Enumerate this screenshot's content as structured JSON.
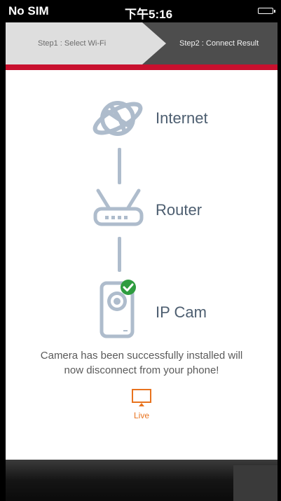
{
  "status_bar": {
    "carrier": "No SIM",
    "time": "下午5:16"
  },
  "steps": [
    {
      "label": "Step1 : Select Wi-Fi",
      "active": false
    },
    {
      "label": "Step2 : Connect Result",
      "active": true
    }
  ],
  "diagram": {
    "internet": {
      "label": "Internet",
      "icon": "globe-icon"
    },
    "router": {
      "label": "Router",
      "icon": "router-icon"
    },
    "camera": {
      "label": "IP Cam",
      "icon": "ip-camera-icon",
      "status": "check-badge-icon"
    }
  },
  "message": {
    "line1": "Camera has been successfully installed will",
    "line2": "now disconnect from your phone!"
  },
  "live_button": {
    "label": "Live",
    "icon": "monitor-icon"
  },
  "colors": {
    "accent_red": "#c8102e",
    "icon_blue": "#aebccc",
    "label_text": "#4d5e70",
    "live_orange": "#e8731e",
    "success_green": "#2e9c3f"
  }
}
